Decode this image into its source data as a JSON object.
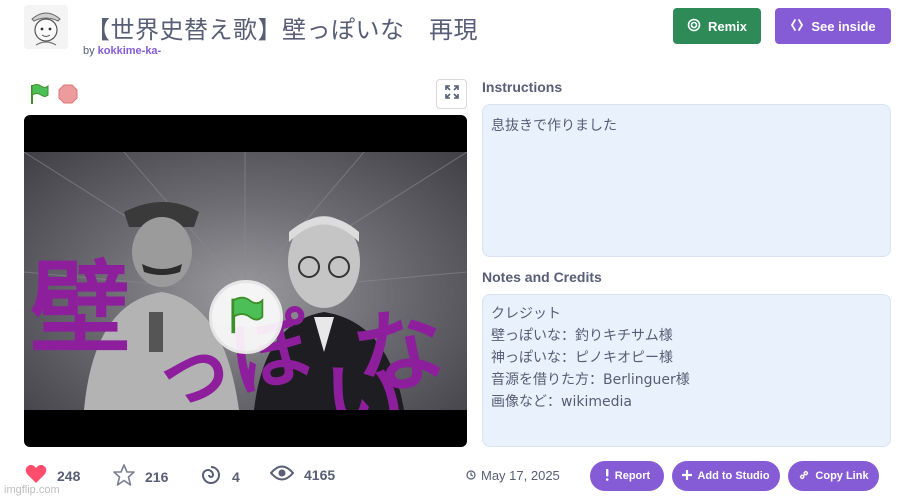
{
  "header": {
    "title": "【世界史替え歌】壁っぽいな　再現",
    "by_label": "by",
    "author": "kokkime-ka-"
  },
  "actions": {
    "remix_label": "Remix",
    "see_inside_label": "See inside"
  },
  "stage": {
    "overlay_text_1": "壁",
    "overlay_text_2": "っぽ",
    "overlay_text_3": "い",
    "overlay_text_4": "な"
  },
  "instructions": {
    "label": "Instructions",
    "text": "息抜きで作りました"
  },
  "notes": {
    "label": "Notes and Credits",
    "lines": [
      "クレジット",
      "壁っぽいな：釣りキチサム様",
      "神っぽいな：ピノキオピー様",
      "音源を借りた方：Berlinguer様",
      "画像など：wikimedia"
    ]
  },
  "stats": {
    "loves": "248",
    "favorites": "216",
    "remixes": "4",
    "views": "4165"
  },
  "date": "May 17, 2025",
  "footer_buttons": {
    "report": "Report",
    "add_to_studio": "Add to Studio",
    "copy_link": "Copy Link"
  },
  "watermark": "imgflip.com",
  "colors": {
    "brand_purple": "#855cd6",
    "remix_green": "#2e8b57",
    "panel_bg": "#e9f1fc",
    "text": "#575e75"
  }
}
